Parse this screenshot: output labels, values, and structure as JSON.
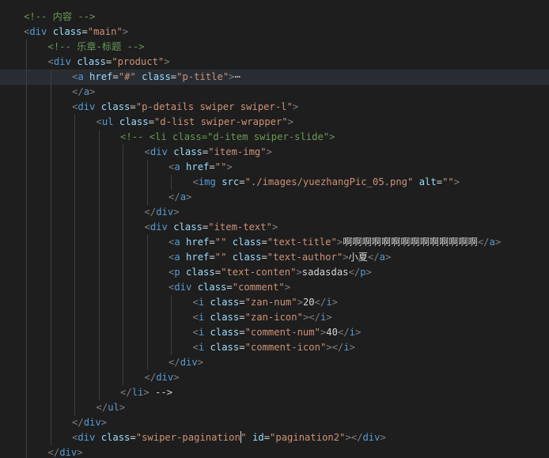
{
  "editor": {
    "language": "html",
    "colors": {
      "background": "#1e1e1e",
      "active_line": "#282d33",
      "comment": "#6a9955",
      "punctuation": "#808080",
      "tag": "#569cd6",
      "attribute": "#9cdcfe",
      "string": "#ce9178",
      "text": "#d4d4d4",
      "indent_guide": "#404040"
    },
    "lines": [
      {
        "indent": 0,
        "text": "<!-- 内容 -->"
      },
      {
        "indent": 0,
        "text": "<div class=\"main\">"
      },
      {
        "indent": 1,
        "text": "<!-- 乐章-标题 -->"
      },
      {
        "indent": 1,
        "text": "<div class=\"product\">"
      },
      {
        "indent": 2,
        "text": "<a href=\"#\" class=\"p-title\">",
        "folded": true,
        "fold_marker": "⋯",
        "active": true
      },
      {
        "indent": 2,
        "text": "</a>"
      },
      {
        "indent": 2,
        "text": "<div class=\"p-details swiper swiper-l\">"
      },
      {
        "indent": 3,
        "text": "<ul class=\"d-list swiper-wrapper\">"
      },
      {
        "indent": 4,
        "text": "<!-- <li class=\"d-item swiper-slide\">"
      },
      {
        "indent": 5,
        "text": "<div class=\"item-img\">"
      },
      {
        "indent": 6,
        "text": "<a href=\"\">"
      },
      {
        "indent": 7,
        "text": "<img src=\"./images/yuezhangPic_05.png\" alt=\"\">"
      },
      {
        "indent": 6,
        "text": "</a>"
      },
      {
        "indent": 5,
        "text": "</div>"
      },
      {
        "indent": 5,
        "text": "<div class=\"item-text\">"
      },
      {
        "indent": 6,
        "text": "<a href=\"\" class=\"text-title\">啊啊啊啊啊啊啊啊啊啊啊啊啊啊</a>"
      },
      {
        "indent": 6,
        "text": "<a href=\"\" class=\"text-author\">小夏</a>"
      },
      {
        "indent": 6,
        "text": "<p class=\"text-conten\">sadasdas</p>"
      },
      {
        "indent": 6,
        "text": "<div class=\"comment\">"
      },
      {
        "indent": 7,
        "text": "<i class=\"zan-num\">20</i>"
      },
      {
        "indent": 7,
        "text": "<i class=\"zan-icon\"></i>"
      },
      {
        "indent": 7,
        "text": "<i class=\"comment-num\">40</i>"
      },
      {
        "indent": 7,
        "text": "<i class=\"comment-icon\"></i>"
      },
      {
        "indent": 6,
        "text": "</div>"
      },
      {
        "indent": 5,
        "text": "</div>"
      },
      {
        "indent": 4,
        "text": "</li> -->"
      },
      {
        "indent": 3,
        "text": "</ul>"
      },
      {
        "indent": 2,
        "text": "</div>"
      },
      {
        "indent": 2,
        "text": "<div class=\"swiper-pagination\" id=\"pagination2\"></div>",
        "cursor_after": "<div class=\"swiper-pagination"
      },
      {
        "indent": 1,
        "text": "</div>"
      }
    ]
  }
}
